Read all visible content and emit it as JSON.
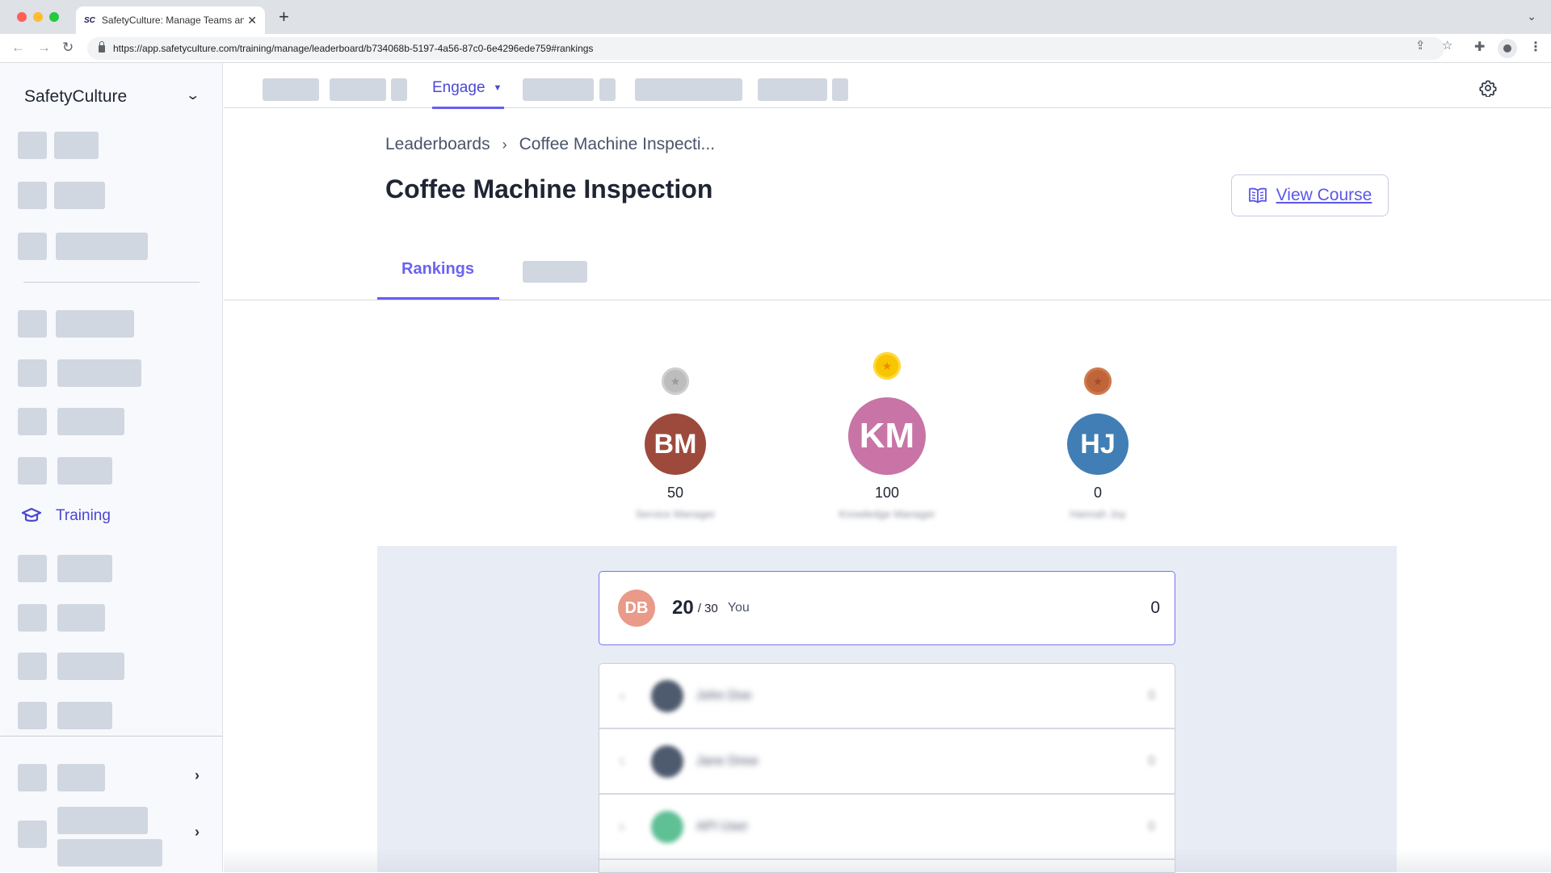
{
  "browser": {
    "tab_title": "SafetyCulture: Manage Teams and ...",
    "favicon_text": "SC",
    "url": "https://app.safetyculture.com/training/manage/leaderboard/b734068b-5197-4a56-87c0-6e4296ede759#rankings"
  },
  "sidebar": {
    "org_name": "SafetyCulture",
    "active_item": {
      "label": "Training",
      "icon": "graduation-cap-icon"
    }
  },
  "topnav": {
    "active_tab": "Engage"
  },
  "breadcrumb": {
    "items": [
      "Leaderboards",
      "Coffee Machine Inspecti..."
    ]
  },
  "page": {
    "title": "Coffee Machine Inspection",
    "view_course_label": "View Course"
  },
  "tabs": {
    "active": "Rankings"
  },
  "podium": [
    {
      "place": 2,
      "medal": "silver",
      "initials": "BM",
      "score": "50",
      "name": "Service Manager",
      "color": "#9d4a3c"
    },
    {
      "place": 1,
      "medal": "gold",
      "initials": "KM",
      "score": "100",
      "name": "Knowledge Manager",
      "color": "#c874a6"
    },
    {
      "place": 3,
      "medal": "bronze",
      "initials": "HJ",
      "score": "0",
      "name": "Hannah Joy",
      "color": "#417eb6"
    }
  ],
  "me": {
    "initials": "DB",
    "rank": "20",
    "total": "/ 30",
    "label": "You",
    "score": "0"
  },
  "rankings": [
    {
      "rank": "4",
      "name": "John Doe",
      "score": "0",
      "color": "#4e5a6e"
    },
    {
      "rank": "5",
      "name": "Jane Drew",
      "score": "0",
      "color": "#4e5a6e"
    },
    {
      "rank": "6",
      "name": "API User",
      "score": "0",
      "color": "#5fbf95"
    }
  ]
}
